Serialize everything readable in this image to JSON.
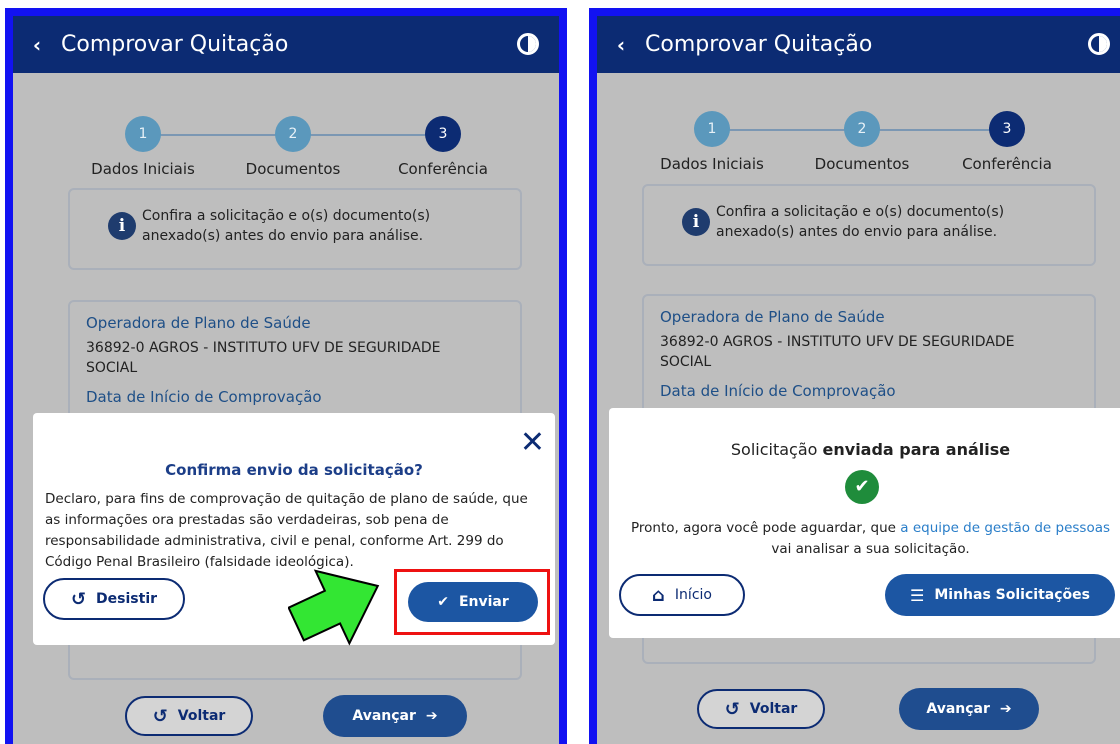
{
  "left": {
    "header": {
      "back_icon": "‹",
      "title": "Comprovar Quitação",
      "contrast_icon": "contrast-icon"
    },
    "steps": [
      {
        "number": "1",
        "label": "Dados Iniciais"
      },
      {
        "number": "2",
        "label": "Documentos"
      },
      {
        "number": "3",
        "label": "Conferência"
      }
    ],
    "info": {
      "icon": "i",
      "text": "Confira a solicitação e o(s) documento(s) anexado(s) antes do envio para análise."
    },
    "details": {
      "operator_label": "Operadora de Plano de Saúde",
      "operator_value": "36892-0 AGROS - INSTITUTO UFV DE SEGURIDADE SOCIAL",
      "start_label": "Data de Início de Comprovação"
    },
    "modal": {
      "close_icon": "✕",
      "title": "Confirma envio da solicitação?",
      "body": "Declaro, para fins de comprovação de quitação de plano de saúde, que as informações ora prestadas são verdadeiras, sob pena de responsabilidade administrativa, civil e penal, conforme Art. 299 do Código Penal Brasileiro (falsidade ideológica).",
      "cancel_label": "Desistir",
      "cancel_icon": "↺",
      "confirm_label": "Enviar",
      "confirm_icon": "✔"
    },
    "footer": {
      "back_label": "Voltar",
      "back_icon": "↺",
      "next_label": "Avançar",
      "next_icon": "➔"
    }
  },
  "right": {
    "header": {
      "back_icon": "‹",
      "title": "Comprovar Quitação",
      "contrast_icon": "contrast-icon"
    },
    "steps": [
      {
        "number": "1",
        "label": "Dados Iniciais"
      },
      {
        "number": "2",
        "label": "Documentos"
      },
      {
        "number": "3",
        "label": "Conferência"
      }
    ],
    "info": {
      "icon": "i",
      "text": "Confira a solicitação e o(s) documento(s) anexado(s) antes do envio para análise."
    },
    "details": {
      "operator_label": "Operadora de Plano de Saúde",
      "operator_value": "36892-0 AGROS - INSTITUTO UFV DE SEGURIDADE SOCIAL",
      "start_label": "Data de Início de Comprovação"
    },
    "modal": {
      "title_prefix": "Solicitação ",
      "title_bold": "enviada para análise",
      "check_icon": "✔",
      "body_prefix": "Pronto, agora você pode aguardar, que ",
      "body_link": "a equipe de gestão de pessoas",
      "body_suffix": "vai analisar a sua solicitação.",
      "home_label": "Início",
      "home_icon": "⌂",
      "requests_label": "Minhas Solicitações",
      "requests_icon": "☰"
    },
    "footer": {
      "back_label": "Voltar",
      "back_icon": "↺",
      "next_label": "Avançar",
      "next_icon": "➔"
    }
  },
  "colors": {
    "frame": "#1212f2",
    "header": "#0c2b73",
    "step_done": "#5b98bc",
    "highlight": "#ee1111",
    "arrow": "#33e633",
    "success": "#1f8c3b"
  }
}
